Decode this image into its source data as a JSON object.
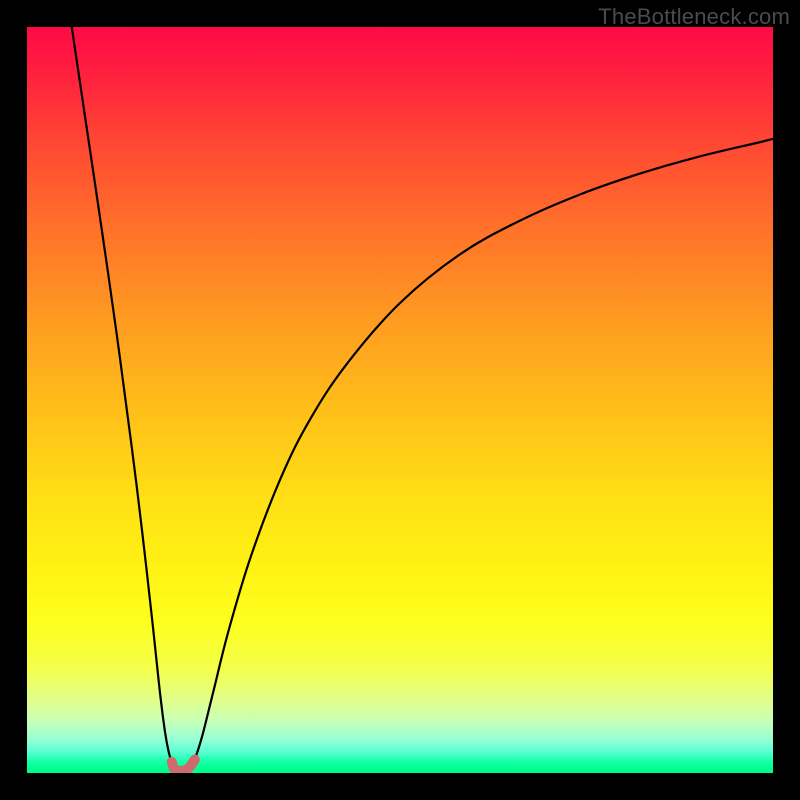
{
  "watermark": "TheBottleneck.com",
  "chart_data": {
    "type": "line",
    "title": "",
    "xlabel": "",
    "ylabel": "",
    "xlim": [
      0,
      100
    ],
    "ylim": [
      0,
      100
    ],
    "gradient_stops": [
      {
        "pos": 0,
        "color": "#ff0a45"
      },
      {
        "pos": 6,
        "color": "#ff1f3f"
      },
      {
        "pos": 15,
        "color": "#ff4534"
      },
      {
        "pos": 26,
        "color": "#ff6e2a"
      },
      {
        "pos": 38,
        "color": "#ff9722"
      },
      {
        "pos": 50,
        "color": "#ffbb1a"
      },
      {
        "pos": 63,
        "color": "#ffdf15"
      },
      {
        "pos": 73,
        "color": "#fff314"
      },
      {
        "pos": 80,
        "color": "#fdff1e"
      },
      {
        "pos": 86,
        "color": "#f3ff4b"
      },
      {
        "pos": 90,
        "color": "#e2ff87"
      },
      {
        "pos": 93,
        "color": "#c8ffb6"
      },
      {
        "pos": 95.5,
        "color": "#97ffd6"
      },
      {
        "pos": 97.2,
        "color": "#58ffd0"
      },
      {
        "pos": 98.3,
        "color": "#1dffb0"
      },
      {
        "pos": 99.3,
        "color": "#00ff90"
      },
      {
        "pos": 100,
        "color": "#00ff7e"
      }
    ],
    "series": [
      {
        "name": "left-branch",
        "color": "#000000",
        "x": [
          6.0,
          8.0,
          10.0,
          12.0,
          14.0,
          15.0,
          16.0,
          17.0,
          17.8,
          18.5,
          19.0,
          19.4
        ],
        "y": [
          100.0,
          86.5,
          73.0,
          59.0,
          44.0,
          36.0,
          27.5,
          18.5,
          11.0,
          5.5,
          2.8,
          1.5
        ]
      },
      {
        "name": "valley-bottom",
        "color": "#cf6a6f",
        "x": [
          19.4,
          19.7,
          20.3,
          21.0,
          21.6,
          22.1,
          22.5
        ],
        "y": [
          1.5,
          0.6,
          0.3,
          0.3,
          0.6,
          1.2,
          1.8
        ]
      },
      {
        "name": "right-branch",
        "color": "#000000",
        "x": [
          22.5,
          23.5,
          25.0,
          27.0,
          30.0,
          34.0,
          38.0,
          43.0,
          50.0,
          58.0,
          66.0,
          74.0,
          82.0,
          90.0,
          98.0,
          100.0
        ],
        "y": [
          1.8,
          5.0,
          11.0,
          19.0,
          29.0,
          39.5,
          47.5,
          55.0,
          63.0,
          69.5,
          74.0,
          77.5,
          80.3,
          82.6,
          84.5,
          85.0
        ]
      }
    ]
  }
}
